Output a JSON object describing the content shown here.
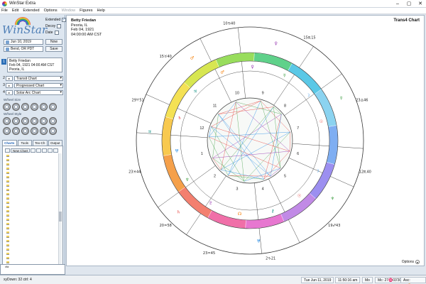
{
  "window": {
    "title": "WinStar Extra",
    "minimize": "–",
    "maximize": "▢",
    "close": "✕"
  },
  "menu": {
    "items": [
      "File",
      "Edit",
      "Extended",
      "Options",
      "Window",
      "Figures",
      "Help"
    ],
    "disabled": [
      "Window"
    ]
  },
  "sidebar": {
    "logo": "WinStar",
    "checks": [
      {
        "label": "Extended",
        "checked": true
      },
      {
        "label": "Decoy",
        "checked": false
      },
      {
        "label": "Date",
        "checked": false
      }
    ],
    "date_field": "Jun 10, 2019",
    "place_field": "Bend, OR PDT",
    "now_button": "Now",
    "save_button": "Save",
    "subject": {
      "number": "1",
      "lines": [
        "Betty Friedan",
        "Feb 04, 1921 04:00 AM CST",
        "Peoria, IL"
      ]
    },
    "charts": [
      {
        "n": "2",
        "type": "Transit Chart"
      },
      {
        "n": "3",
        "type": "Progressed Chart"
      },
      {
        "n": "4",
        "type": "Solar Arc Chart"
      }
    ],
    "wheel_size_label": "W/heel Size",
    "wheel_style_label": "W/heel Style",
    "tabs": [
      "Charts",
      "Tools",
      "Tex-Ch",
      "Output"
    ],
    "new_chart_label": "New Chart",
    "tree_file": "1Untitled.chf",
    "bottom_list": [
      "xfa"
    ]
  },
  "main": {
    "chart_title": "Trans4 Chart",
    "person": {
      "name": "Betty Friedan",
      "place": "Peoria, IL",
      "date": "Feb 04, 1921",
      "time": "04:00:00 AM CST"
    },
    "options_label": "Options",
    "cusp_labels": [
      "10♋40",
      "15♉40",
      "29♈51",
      "23♓44",
      "20♒58",
      "23♒45",
      "2♑21",
      "19♐43",
      "12♏40",
      "23♎46",
      "15♏15"
    ],
    "house_numbers": [
      "1",
      "2",
      "3",
      "4",
      "5",
      "6",
      "7",
      "8",
      "9",
      "10",
      "11",
      "12"
    ]
  },
  "status": {
    "left": "xyDown: 32 ctrl: 4",
    "date": "Tue Jun 11, 2019",
    "time": "11:50:16 am",
    "weekday": "Mo",
    "mc": "Mc: 27♓03'30",
    "asc": "Asc: 22♊43'41"
  },
  "colors": {
    "accent": "#2c6fb7",
    "zodiac": [
      "#8bd3f0",
      "#5bc8e6",
      "#5fd18a",
      "#98dd5c",
      "#d7e651",
      "#f4e154",
      "#f8c94f",
      "#f5a04a",
      "#f37f6f",
      "#f06fa8",
      "#e777d0",
      "#c18ae6",
      "#9c8ff0",
      "#7faef2"
    ]
  }
}
